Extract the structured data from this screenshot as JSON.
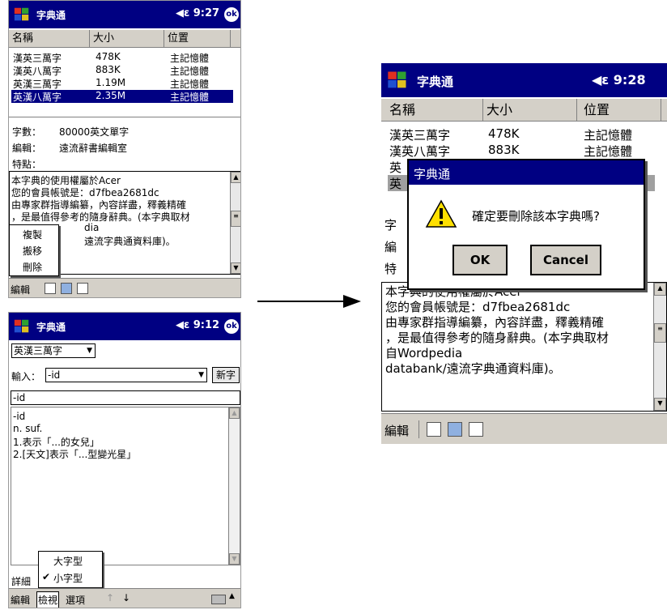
{
  "screen1": {
    "app_title": "字典通",
    "time": "9:27",
    "ok_label": "ok",
    "columns": [
      "名稱",
      "大小",
      "位置"
    ],
    "rows": [
      {
        "name": "漢英三萬字",
        "size": "478K",
        "location": "主記憶體"
      },
      {
        "name": "漢英八萬字",
        "size": "883K",
        "location": "主記憶體"
      },
      {
        "name": "英漢三萬字",
        "size": "1.19M",
        "location": "主記憶體"
      },
      {
        "name": "英漢八萬字",
        "size": "2.35M",
        "location": "主記憶體",
        "selected": true
      }
    ],
    "info": [
      {
        "label": "字數：",
        "value": "80000英文單字"
      },
      {
        "label": "編輯：",
        "value": "遠流辭書編輯室"
      },
      {
        "label": "特點：",
        "value": ""
      }
    ],
    "desc_lines": [
      "本字典的使用權屬於Acer",
      "您的會員帳號是：d7fbea2681dc",
      "由專家群指導編纂，內容詳盡，釋義精確",
      "，是最值得參考的隨身辭典。(本字典取材",
      "dia",
      "遠流字典通資料庫)。"
    ],
    "context_menu": [
      "複製",
      "搬移",
      "刪除"
    ],
    "menu_label": "編輯"
  },
  "screen2": {
    "app_title": "字典通",
    "time": "9:12",
    "ok_label": "ok",
    "dict_select": "英漢三萬字",
    "input_label": "輸入：",
    "input_value": "-id",
    "new_word_button": "新字",
    "word_field": "-id",
    "definition_lines": [
      "-id",
      "n. suf.",
      "1.表示「...的女兒」",
      "2.[天文]表示「...型變光星」"
    ],
    "font_menu": [
      "大字型",
      "小字型"
    ],
    "font_menu_checked": "小字型",
    "detail_label": "詳細",
    "menu_items": [
      "編輯",
      "檢視",
      "選項"
    ]
  },
  "screen3": {
    "app_title": "字典通",
    "time": "9:28",
    "columns": [
      "名稱",
      "大小",
      "位置"
    ],
    "rows": [
      {
        "name": "漢英三萬字",
        "size": "478K",
        "location": "主記憶體"
      },
      {
        "name": "漢英八萬字",
        "size": "883K",
        "location": "主記憶體"
      },
      {
        "name": "英",
        "size": "",
        "location": ""
      },
      {
        "name": "英",
        "size": "",
        "location": "",
        "selected": true
      }
    ],
    "info_labels": [
      "字",
      "編",
      "特"
    ],
    "desc_lines": [
      "本字典的使用權屬於Acer",
      "您的會員帳號是：d7fbea2681dc",
      "由專家群指導編纂，內容詳盡，釋義精確",
      "，是最值得參考的隨身辭典。(本字典取材",
      "自Wordpedia",
      "databank/遠流字典通資料庫)。"
    ],
    "dialog": {
      "title": "字典通",
      "message": "確定要刪除該本字典嗎?",
      "ok": "OK",
      "cancel": "Cancel"
    },
    "menu_label": "編輯"
  },
  "colors": {
    "titlebar": "#000082",
    "bar": "#d4d0c8",
    "selection": "#000082"
  }
}
